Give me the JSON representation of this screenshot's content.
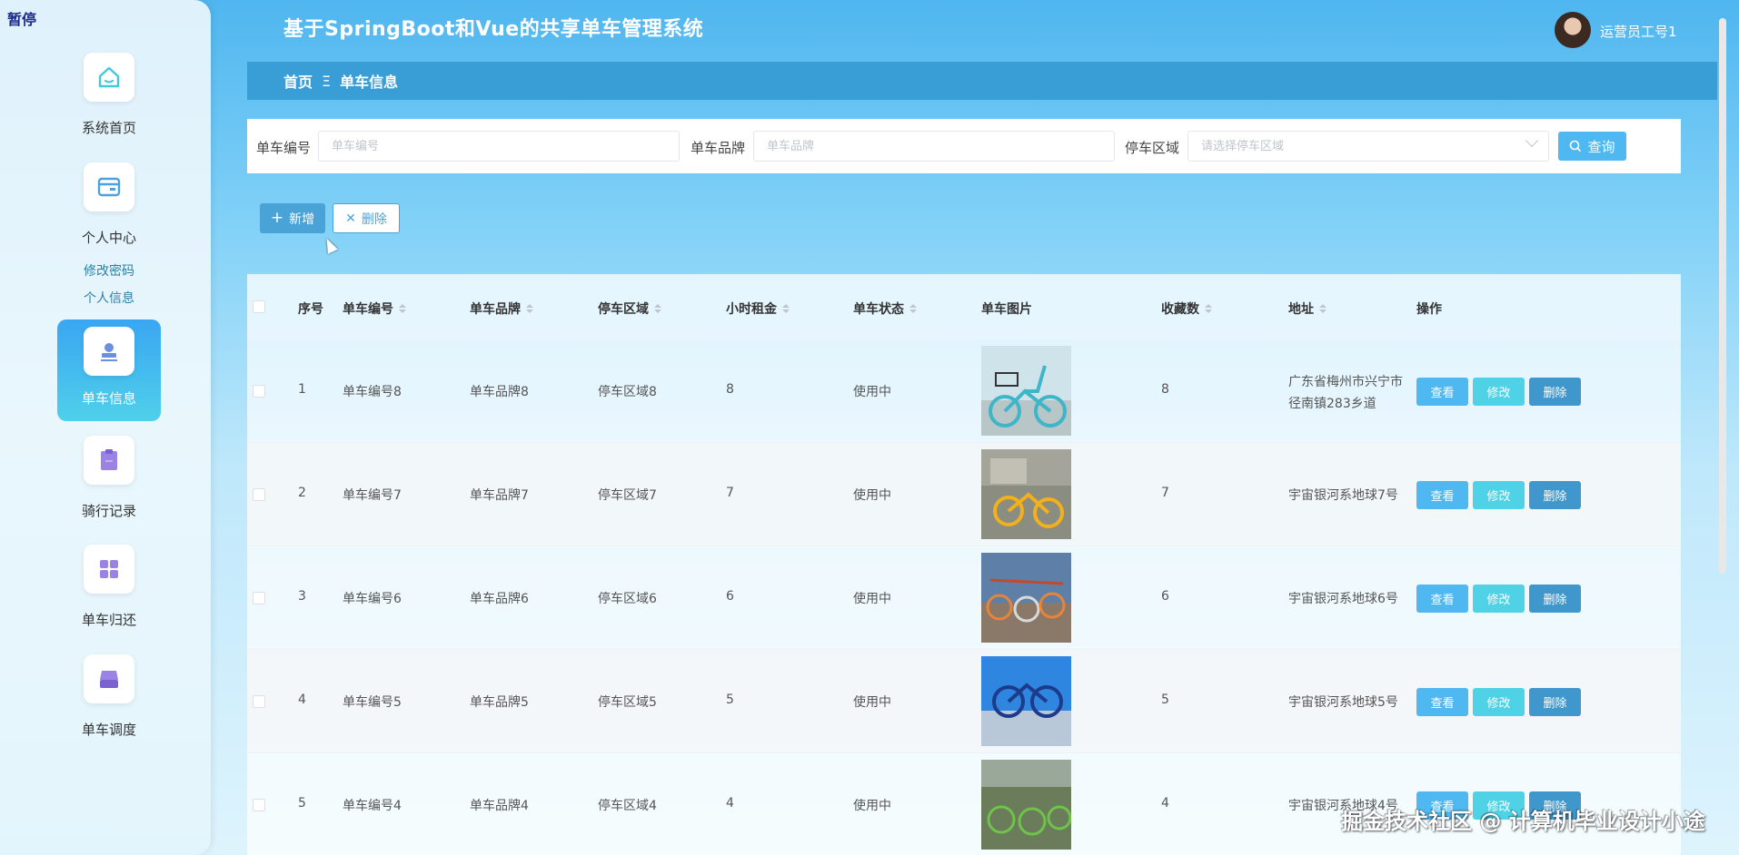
{
  "overlay": {
    "pause_label": "暂停"
  },
  "header": {
    "title": "基于SpringBoot和Vue的共享单车管理系统",
    "user_name": "运营员工号1"
  },
  "sidebar": {
    "items": [
      {
        "label": "系统首页",
        "icon": "home-icon"
      },
      {
        "label": "个人中心",
        "icon": "wallet-icon"
      },
      {
        "label": "单车信息",
        "icon": "stamp-icon"
      },
      {
        "label": "骑行记录",
        "icon": "clipboard-icon"
      },
      {
        "label": "单车归还",
        "icon": "grid-icon"
      },
      {
        "label": "单车调度",
        "icon": "tray-icon"
      }
    ],
    "submenu": [
      "修改密码",
      "个人信息"
    ]
  },
  "breadcrumb": {
    "home": "首页",
    "separator": "Ξ",
    "current": "单车信息"
  },
  "search": {
    "bike_no_label": "单车编号",
    "bike_no_placeholder": "单车编号",
    "brand_label": "单车品牌",
    "brand_placeholder": "单车品牌",
    "area_label": "停车区域",
    "area_placeholder": "请选择停车区域",
    "search_button": "查询"
  },
  "actions": {
    "add": "新增",
    "delete": "删除"
  },
  "table": {
    "headers": [
      "序号",
      "单车编号",
      "单车品牌",
      "停车区域",
      "小时租金",
      "单车状态",
      "单车图片",
      "收藏数",
      "地址",
      "操作"
    ],
    "row_buttons": {
      "view": "查看",
      "edit": "修改",
      "delete": "删除"
    },
    "rows": [
      {
        "index": "1",
        "bike_no": "单车编号8",
        "brand": "单车品牌8",
        "area": "停车区域8",
        "rent": "8",
        "status": "使用中",
        "favorites": "8",
        "address": "广东省梅州市兴宁市径南镇283乡道"
      },
      {
        "index": "2",
        "bike_no": "单车编号7",
        "brand": "单车品牌7",
        "area": "停车区域7",
        "rent": "7",
        "status": "使用中",
        "favorites": "7",
        "address": "宇宙银河系地球7号"
      },
      {
        "index": "3",
        "bike_no": "单车编号6",
        "brand": "单车品牌6",
        "area": "停车区域6",
        "rent": "6",
        "status": "使用中",
        "favorites": "6",
        "address": "宇宙银河系地球6号"
      },
      {
        "index": "4",
        "bike_no": "单车编号5",
        "brand": "单车品牌5",
        "area": "停车区域5",
        "rent": "5",
        "status": "使用中",
        "favorites": "5",
        "address": "宇宙银河系地球5号"
      },
      {
        "index": "5",
        "bike_no": "单车编号4",
        "brand": "单车品牌4",
        "area": "停车区域4",
        "rent": "4",
        "status": "使用中",
        "favorites": "4",
        "address": "宇宙银河系地球4号"
      }
    ]
  },
  "watermark": "掘金技术社区 @ 计算机毕业设计小途",
  "colors": {
    "primary": "#4fb8f0",
    "breadcrumb_bg": "#3a9ed6",
    "edit": "#4fd2e6",
    "delete": "#3f97cc"
  }
}
